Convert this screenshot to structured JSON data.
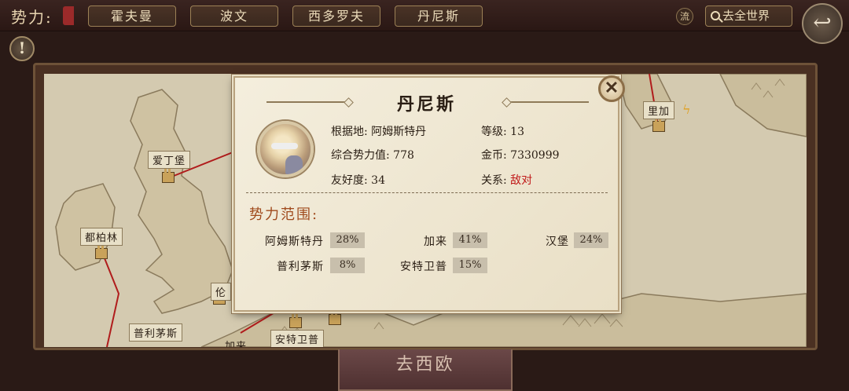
{
  "top_bar": {
    "force_label": "势力:",
    "factions": [
      "霍夫曼",
      "波文",
      "西多罗夫",
      "丹尼斯"
    ],
    "flow_label": "流",
    "world_button": "去全世界"
  },
  "map": {
    "cities": {
      "aidingbao": "爱丁堡",
      "dubolin": "都柏林",
      "lun": "伦",
      "pulimaosi": "普利茅斯",
      "jialai": "加来",
      "anteweipu": "安特卫普",
      "lijia": "里加"
    }
  },
  "bottom_button": "去西欧",
  "popup": {
    "title": "丹尼斯",
    "close_symbol": "✕",
    "base_label": "根据地:",
    "base_value": "阿姆斯特丹",
    "level_label": "等级:",
    "level_value": "13",
    "power_label": "综合势力值:",
    "power_value": "778",
    "gold_label": "金币:",
    "gold_value": "7330999",
    "friendship_label": "友好度:",
    "friendship_value": "34",
    "relation_label": "关系:",
    "relation_value": "敌对",
    "scope_title": "势力范围:",
    "zones": [
      {
        "name": "阿姆斯特丹",
        "pct": "28%"
      },
      {
        "name": "加来",
        "pct": "41%"
      },
      {
        "name": "汉堡",
        "pct": "24%"
      },
      {
        "name": "普利茅斯",
        "pct": "8%"
      },
      {
        "name": "安特卫普",
        "pct": "15%"
      }
    ]
  },
  "colors": {
    "relation_enemy": "#c01818",
    "scope_title": "#a04a1c"
  }
}
